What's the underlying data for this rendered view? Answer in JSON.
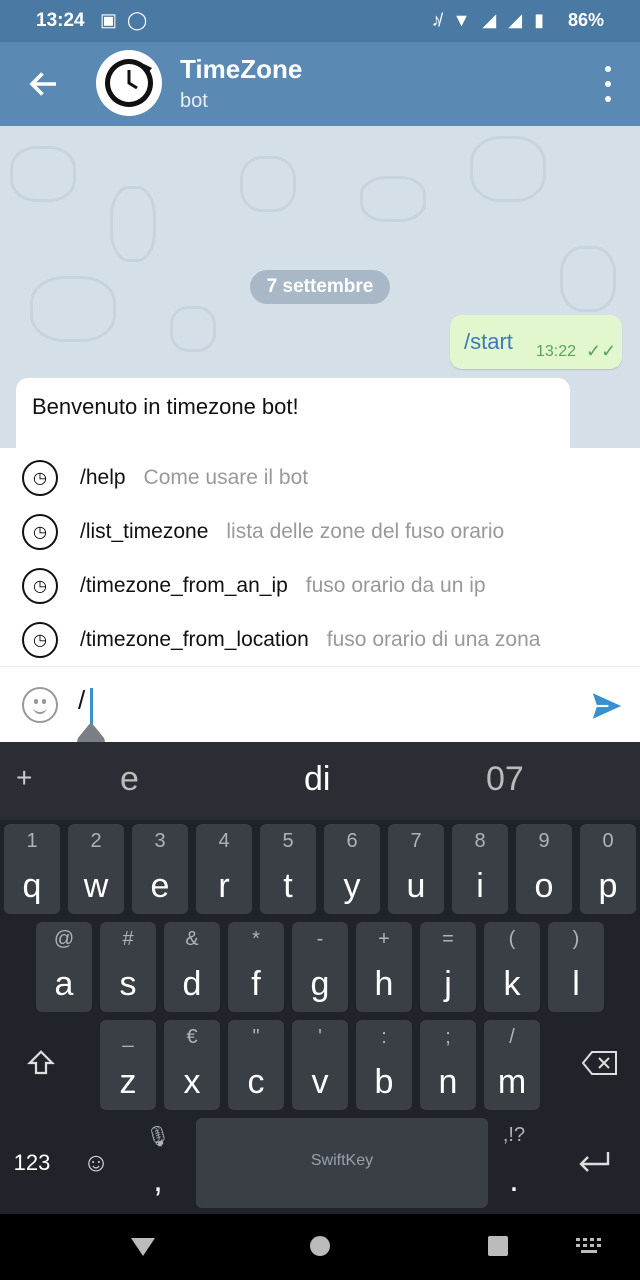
{
  "status_bar": {
    "time": "13:24",
    "battery": "86%"
  },
  "header": {
    "title": "TimeZone",
    "subtitle": "bot"
  },
  "chat": {
    "date_chip": "7 settembre",
    "outgoing": {
      "text": "/start",
      "time": "13:22"
    },
    "incoming": {
      "text": "Benvenuto in timezone bot!"
    }
  },
  "suggestions": [
    {
      "command": "/help",
      "description": "Come usare il bot"
    },
    {
      "command": "/list_timezone",
      "description": "lista delle zone del fuso orario"
    },
    {
      "command": "/timezone_from_an_ip",
      "description": "fuso orario da un ip"
    },
    {
      "command": "/timezone_from_location",
      "description": "fuso orario di una zona"
    }
  ],
  "input": {
    "value": "/"
  },
  "keyboard": {
    "predictions": [
      "e",
      "di",
      "07"
    ],
    "row1": [
      {
        "alt": "1",
        "main": "q"
      },
      {
        "alt": "2",
        "main": "w"
      },
      {
        "alt": "3",
        "main": "e"
      },
      {
        "alt": "4",
        "main": "r"
      },
      {
        "alt": "5",
        "main": "t"
      },
      {
        "alt": "6",
        "main": "y"
      },
      {
        "alt": "7",
        "main": "u"
      },
      {
        "alt": "8",
        "main": "i"
      },
      {
        "alt": "9",
        "main": "o"
      },
      {
        "alt": "0",
        "main": "p"
      }
    ],
    "row2": [
      {
        "alt": "@",
        "main": "a"
      },
      {
        "alt": "#",
        "main": "s"
      },
      {
        "alt": "&",
        "main": "d"
      },
      {
        "alt": "*",
        "main": "f"
      },
      {
        "alt": "-",
        "main": "g"
      },
      {
        "alt": "+",
        "main": "h"
      },
      {
        "alt": "=",
        "main": "j"
      },
      {
        "alt": "(",
        "main": "k"
      },
      {
        "alt": ")",
        "main": "l"
      }
    ],
    "row3": [
      {
        "alt": "_",
        "main": "z"
      },
      {
        "alt": "€",
        "main": "x"
      },
      {
        "alt": "\"",
        "main": "c"
      },
      {
        "alt": "'",
        "main": "v"
      },
      {
        "alt": ":",
        "main": "b"
      },
      {
        "alt": ";",
        "main": "n"
      },
      {
        "alt": "/",
        "main": "m"
      }
    ],
    "numbers_key": "123",
    "comma_key": ",",
    "space_label": "SwiftKey",
    "punct_alt": ",!?",
    "period_key": "."
  },
  "colors": {
    "header": "#5a8ab3",
    "status_bar": "#4a7aa3",
    "accent": "#3a8fd0"
  }
}
